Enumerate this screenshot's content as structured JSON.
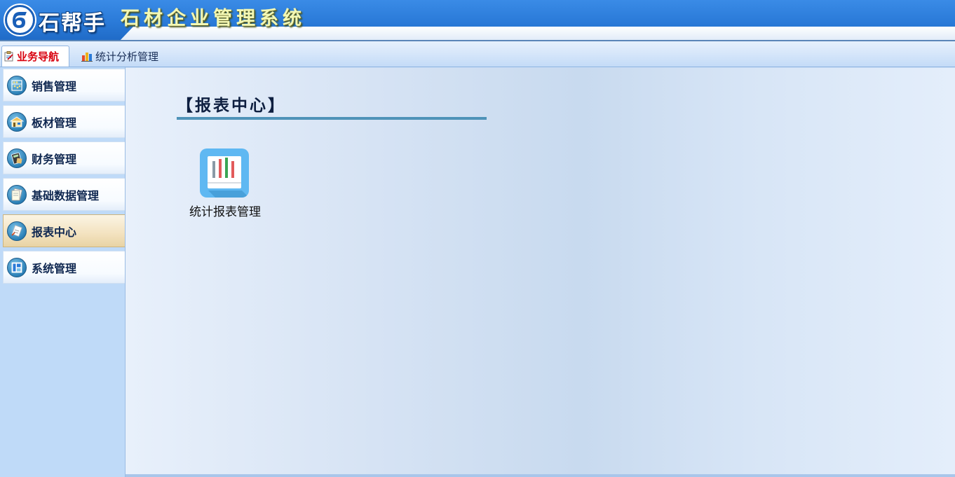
{
  "header": {
    "brand": "石帮手",
    "system_title": "石材企业管理系统"
  },
  "tabs": [
    {
      "label": "业务导航",
      "icon": "clipboard-icon",
      "active": true
    },
    {
      "label": "统计分析管理",
      "icon": "bar-chart-icon",
      "active": false
    }
  ],
  "sidebar": {
    "items": [
      {
        "label": "销售管理",
        "icon": "abacus-icon",
        "active": false
      },
      {
        "label": "板材管理",
        "icon": "warehouse-icon",
        "active": false
      },
      {
        "label": "财务管理",
        "icon": "calculator-icon",
        "active": false
      },
      {
        "label": "基础数据管理",
        "icon": "documents-icon",
        "active": false
      },
      {
        "label": "报表中心",
        "icon": "report-icon",
        "active": true
      },
      {
        "label": "系统管理",
        "icon": "window-icon",
        "active": false
      }
    ]
  },
  "main": {
    "section_title": "【报表中心】",
    "tiles": [
      {
        "label": "统计报表管理",
        "icon": "statistics-report-icon"
      }
    ]
  },
  "colors": {
    "header_blue": "#2a7ad8",
    "active_tab_text": "#d8000e",
    "section_rule": "#4f93b8",
    "tile_icon_bg": "#5fb8f2"
  }
}
